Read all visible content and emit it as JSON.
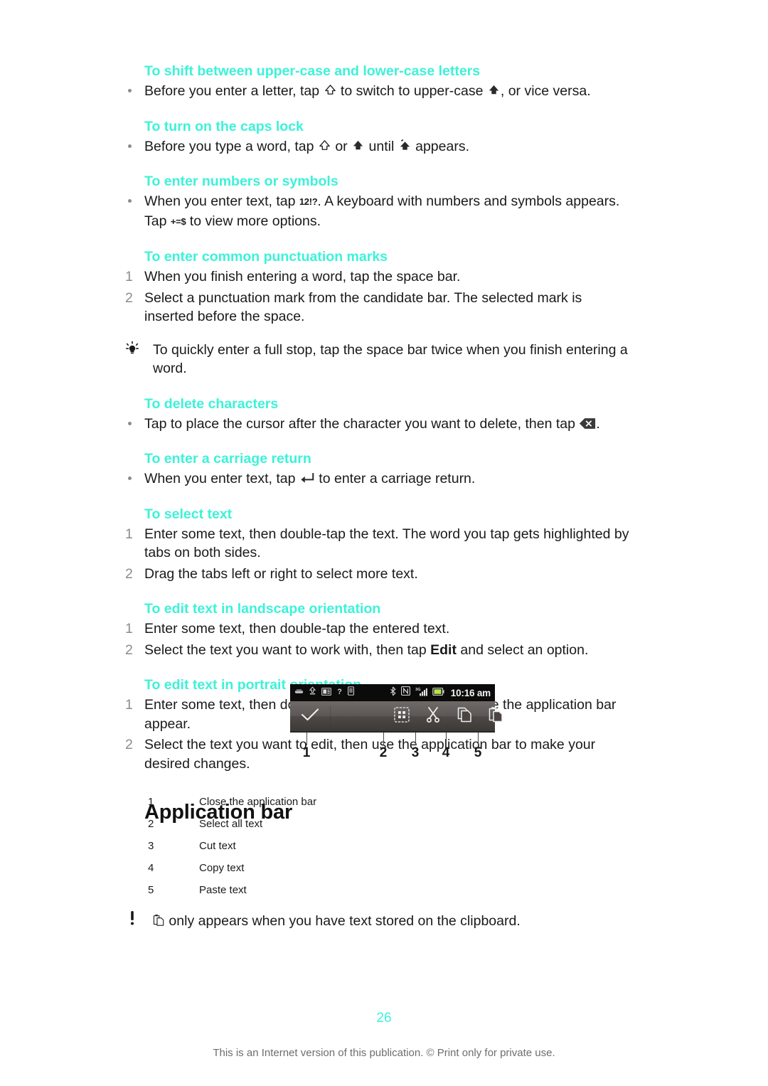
{
  "page": {
    "number": "26",
    "footer": "This is an Internet version of this publication. © Print only for private use.",
    "heading_color": "#3df2d8",
    "text_color": "#1a1a1a"
  },
  "sections": [
    {
      "id": "shift-case",
      "heading": "To shift between upper-case and lower-case letters",
      "items": [
        {
          "marker": "bullet",
          "parts": [
            {
              "type": "text",
              "value": "Before you enter a letter, tap "
            },
            {
              "type": "icon",
              "name": "shift-outline-icon"
            },
            {
              "type": "text",
              "value": " to switch to upper-case "
            },
            {
              "type": "icon",
              "name": "shift-filled-icon"
            },
            {
              "type": "text",
              "value": ", or vice versa."
            }
          ]
        }
      ]
    },
    {
      "id": "caps-lock",
      "heading": "To turn on the caps lock",
      "items": [
        {
          "marker": "bullet",
          "parts": [
            {
              "type": "text",
              "value": "Before you type a word, tap "
            },
            {
              "type": "icon",
              "name": "shift-outline-icon"
            },
            {
              "type": "text",
              "value": " or "
            },
            {
              "type": "icon",
              "name": "shift-filled-icon"
            },
            {
              "type": "text",
              "value": " until "
            },
            {
              "type": "icon",
              "name": "caps-lock-icon"
            },
            {
              "type": "text",
              "value": " appears."
            }
          ]
        }
      ]
    },
    {
      "id": "numbers-symbols",
      "heading": "To enter numbers or symbols",
      "items": [
        {
          "marker": "bullet",
          "parts": [
            {
              "type": "text",
              "value": "When you enter text, tap "
            },
            {
              "type": "keycap",
              "value": "12!?"
            },
            {
              "type": "text",
              "value": ". A keyboard with numbers and symbols appears. Tap "
            },
            {
              "type": "keycap",
              "value": "+=$"
            },
            {
              "type": "text",
              "value": " to view more options."
            }
          ]
        }
      ]
    },
    {
      "id": "punctuation",
      "heading": "To enter common punctuation marks",
      "items": [
        {
          "marker": "1",
          "parts": [
            {
              "type": "text",
              "value": "When you finish entering a word, tap the space bar."
            }
          ]
        },
        {
          "marker": "2",
          "parts": [
            {
              "type": "text",
              "value": "Select a punctuation mark from the candidate bar. The selected mark is inserted before the space."
            }
          ]
        }
      ],
      "note": {
        "icon": "tip-bulb-icon",
        "text": "To quickly enter a full stop, tap the space bar twice when you finish entering a word."
      }
    },
    {
      "id": "delete-characters",
      "heading": "To delete characters",
      "items": [
        {
          "marker": "bullet",
          "parts": [
            {
              "type": "text",
              "value": "Tap to place the cursor after the character you want to delete, then tap "
            },
            {
              "type": "icon",
              "name": "backspace-icon"
            },
            {
              "type": "text",
              "value": "."
            }
          ]
        }
      ]
    },
    {
      "id": "carriage-return",
      "heading": "To enter a carriage return",
      "items": [
        {
          "marker": "bullet",
          "parts": [
            {
              "type": "text",
              "value": "When you enter text, tap "
            },
            {
              "type": "icon",
              "name": "enter-return-icon"
            },
            {
              "type": "text",
              "value": " to enter a carriage return."
            }
          ]
        }
      ]
    },
    {
      "id": "select-text",
      "heading": "To select text",
      "items": [
        {
          "marker": "1",
          "parts": [
            {
              "type": "text",
              "value": "Enter some text, then double-tap the text. The word you tap gets highlighted by tabs on both sides."
            }
          ]
        },
        {
          "marker": "2",
          "parts": [
            {
              "type": "text",
              "value": "Drag the tabs left or right to select more text."
            }
          ]
        }
      ]
    },
    {
      "id": "edit-landscape",
      "heading": "To edit text in landscape orientation",
      "items": [
        {
          "marker": "1",
          "parts": [
            {
              "type": "text",
              "value": "Enter some text, then double-tap the entered text."
            }
          ]
        },
        {
          "marker": "2",
          "parts": [
            {
              "type": "text",
              "value": "Select the text you want to work with, then tap "
            },
            {
              "type": "bold",
              "value": "Edit"
            },
            {
              "type": "text",
              "value": " and select an option."
            }
          ]
        }
      ]
    },
    {
      "id": "edit-portrait",
      "heading": "To edit text in portrait orientation",
      "items": [
        {
          "marker": "1",
          "parts": [
            {
              "type": "text",
              "value": "Enter some text, then double-tap the entered text to make the application bar appear."
            }
          ]
        },
        {
          "marker": "2",
          "parts": [
            {
              "type": "text",
              "value": "Select the text you want to edit, then use the application bar to make your desired changes."
            }
          ]
        }
      ]
    }
  ],
  "application_bar": {
    "title": "Application bar",
    "screenshot": {
      "status_bar": {
        "left_icons": [
          "usb-icon",
          "upload-arrow-icon",
          "sim-card-icon",
          "question-mark-icon",
          "phone-icon"
        ],
        "right_icons": [
          "bluetooth-icon",
          "nfc-icon",
          "signal-bars-icon",
          "battery-icon"
        ],
        "clock": "10:16 am"
      },
      "toolbar_icons": [
        "checkmark-icon",
        "select-all-grid-icon",
        "scissors-cut-icon",
        "copy-pages-icon",
        "paste-clipboard-icon"
      ],
      "callout_numbers": [
        "1",
        "2",
        "3",
        "4",
        "5"
      ]
    },
    "legend": [
      {
        "num": "1",
        "label": "Close the application bar"
      },
      {
        "num": "2",
        "label": "Select all text"
      },
      {
        "num": "3",
        "label": "Cut text"
      },
      {
        "num": "4",
        "label": "Copy text"
      },
      {
        "num": "5",
        "label": "Paste text"
      }
    ],
    "note": {
      "icon": "warning-exclamation-icon",
      "inline_icon": "paste-clipboard-icon",
      "text": " only appears when you have text stored on the clipboard."
    }
  }
}
